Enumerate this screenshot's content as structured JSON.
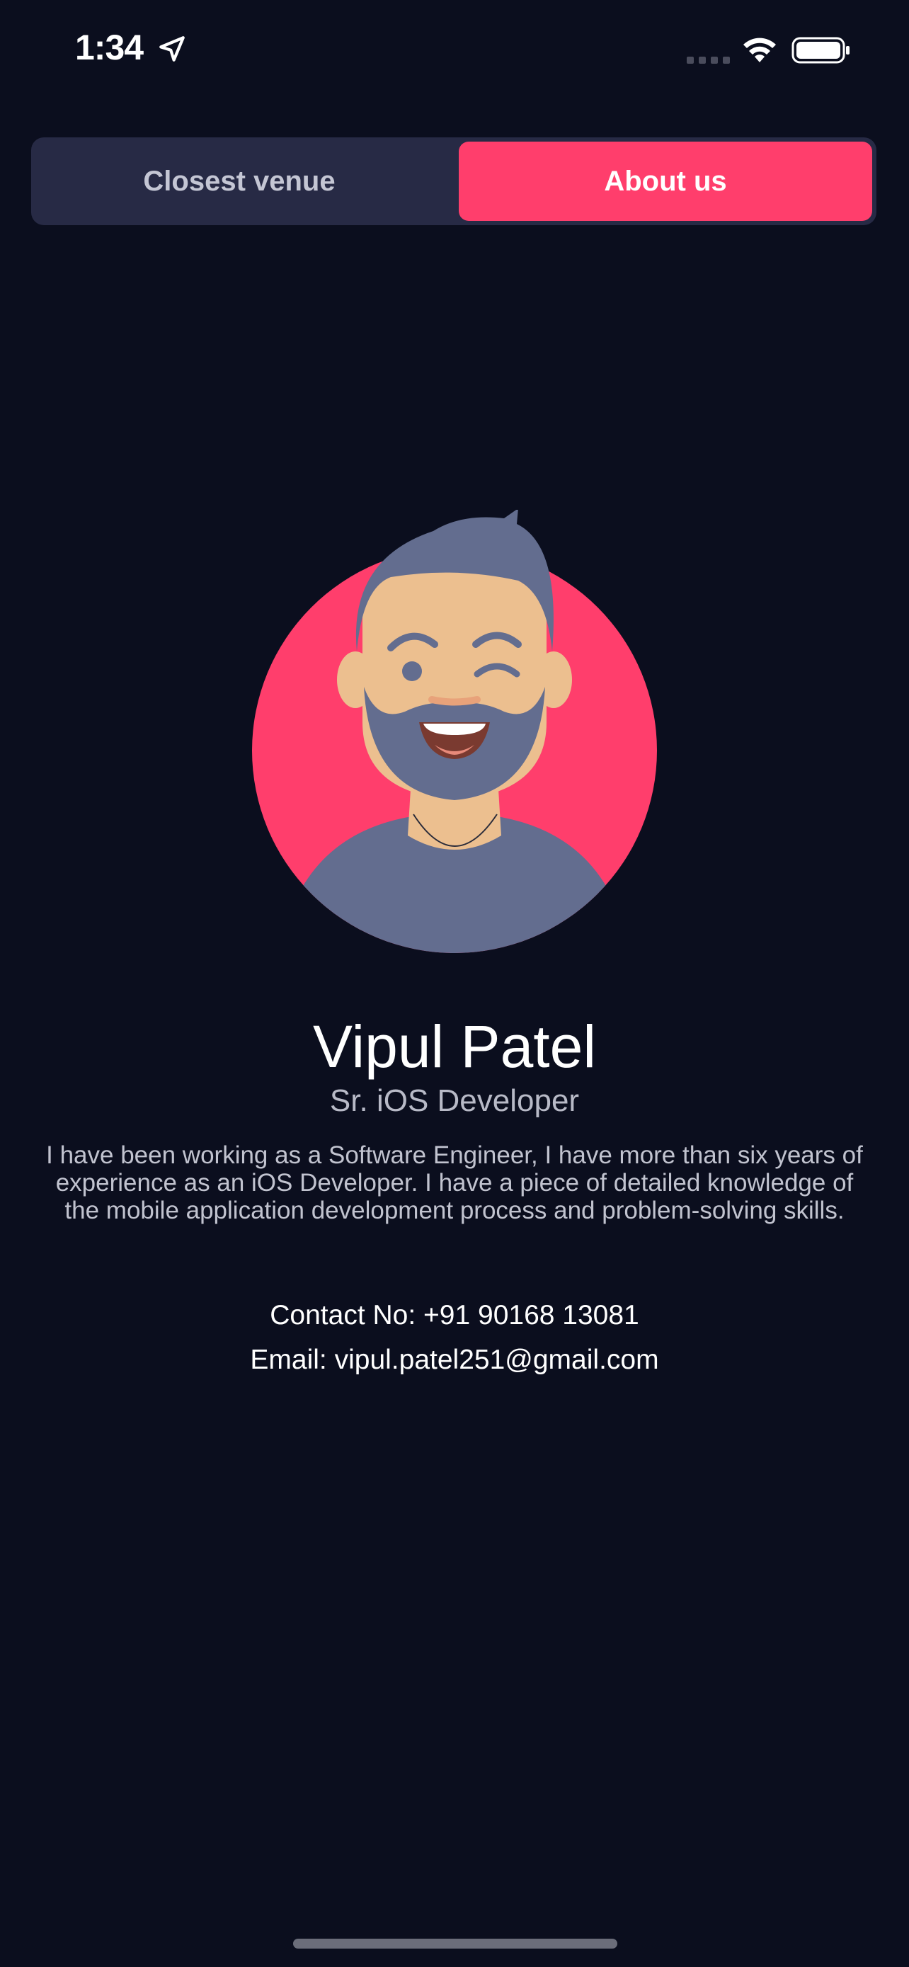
{
  "status_bar": {
    "time": "1:34",
    "location_icon": "location-arrow-icon",
    "signal_icon": "cellular-signal-icon",
    "wifi_icon": "wifi-icon",
    "battery_icon": "battery-icon"
  },
  "tabs": {
    "items": [
      {
        "label": "Closest venue",
        "selected": false
      },
      {
        "label": "About us",
        "selected": true
      }
    ]
  },
  "profile": {
    "avatar_icon": "avatar-illustration",
    "name": "Vipul Patel",
    "role": "Sr. iOS Developer",
    "bio": "I have been working as a Software Engineer, I have more than six years of experience as an iOS Developer. I have a piece of detailed knowledge of the mobile application development process and problem-solving skills.",
    "contact": "Contact No: +91 90168 13081",
    "email": "Email: vipul.patel251@gmail.com"
  },
  "colors": {
    "background": "#0b0e1e",
    "accent": "#ff3e6c",
    "segment_bg": "#272a45",
    "avatar_hair": "#636d8f",
    "avatar_skin": "#ecbf8f"
  }
}
